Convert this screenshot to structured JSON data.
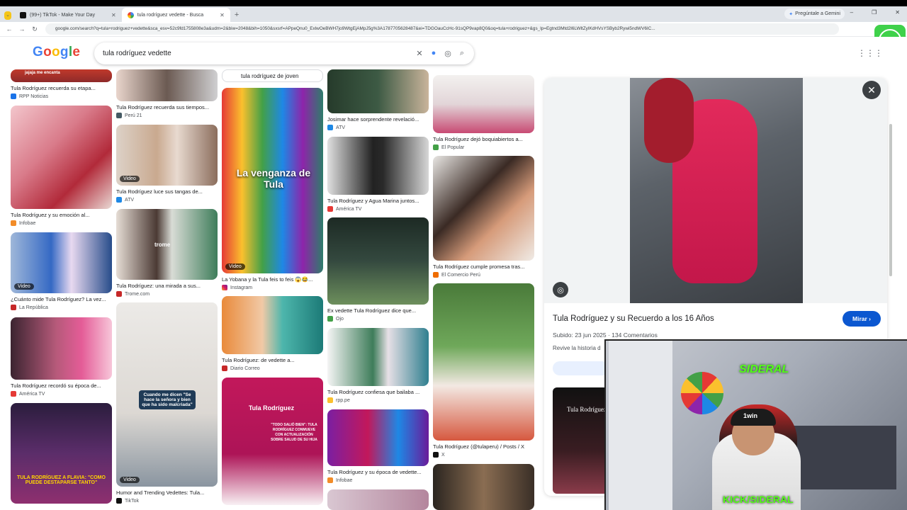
{
  "browser": {
    "tabs": [
      {
        "label": "(99+) TikTok - Make Your Day",
        "active": false
      },
      {
        "label": "tula rodríguez vedette - Busca",
        "active": true
      }
    ],
    "gemini_label": "Pregúntale a Gemini",
    "url": "google.com/search?q=tula+rodriguez+vedette&sca_esv=52c9fd1755808e3a&udm=2&biw=2048&bih=1050&sxsrf=APpeQnu0_ExlwOeBWH7jo9WtgEjAMpJ5g%3A1787705628487&ei=TDGOauCcHc-91sQP9vap8Q0&oq=tula+rodriguez+&gs_lp=Egtnd3Mtd2l6LWltZyIKdHVsYSByb2Rywi5ndWV6IC..."
  },
  "age_badge": "18",
  "google": {
    "logo": "Google",
    "query": "tula rodríguez vedette"
  },
  "results": {
    "col1": [
      {
        "caption": "Tula Rodríguez recuerda su etapa...",
        "source": "RPP Noticias",
        "overlay": "jajaja me encanta"
      },
      {
        "caption": "Tula Rodríguez y su emoción al...",
        "source": "Infobae"
      },
      {
        "caption": "¿Cuánto mide Tula Rodríguez? La vez...",
        "source": "La República",
        "video": "Video"
      },
      {
        "caption": "Tula Rodríguez recordó su época de...",
        "source": "América TV"
      },
      {
        "caption": "",
        "source": "",
        "overlay": "TULA RODRÍGUEZ A FLAVIA: \"COMO PUEDE DESTAPARSE TANTO\""
      }
    ],
    "col2": [
      {
        "caption": "Tula Rodríguez recuerda sus tiempos...",
        "source": "Perú 21"
      },
      {
        "caption": "Tula Rodríguez luce sus tangas de...",
        "source": "ATV",
        "video": "Video"
      },
      {
        "caption": "Tula Rodríguez: una mirada a sus...",
        "source": "Trome.com",
        "overlay": "trome"
      },
      {
        "caption": "Humor and Trending Vedettes: Tula...",
        "source": "TikTok",
        "video": "Video",
        "overlay": "Cuando me dicen \"Se hace la señora y bien que ha sido malcriada\""
      }
    ],
    "col3": [
      {
        "caption": "tula rodríguez de joven",
        "source": ""
      },
      {
        "caption": "La Yobana y la Tula feis to feis 😱😂...",
        "source": "Instagram",
        "video": "Video",
        "overlay": "La venganza de Tula"
      },
      {
        "caption": "Tula Rodríguez: de vedette a...",
        "source": "Diario Correo"
      },
      {
        "caption": "",
        "source": "",
        "overlay": "Tula Rodríguez",
        "overlay2": "\"TODO SALIÓ BIEN\": TULA RODRÍGUEZ CONMUEVE CON ACTUALIZACIÓN SOBRE SALUD DE SU HIJA"
      }
    ],
    "col4": [
      {
        "caption": "Josimar hace sorprendente revelació...",
        "source": "ATV"
      },
      {
        "caption": "Tula Rodríguez y Agua Marina juntos...",
        "source": "América TV"
      },
      {
        "caption": "Ex vedette Tula Rodríguez dice que...",
        "source": "Ojo"
      },
      {
        "caption": "Tula Rodríguez confiesa que bailaba ...",
        "source": "rpp.pe"
      },
      {
        "caption": "Tula Rodríguez y su época de vedette...",
        "source": "Infobae"
      }
    ],
    "col5": [
      {
        "caption": "Tula Rodríguez dejó boquiabiertos a...",
        "source": "El Popular"
      },
      {
        "caption": "Tula Rodríguez cumple promesa tras...",
        "source": "El Comercio Perú"
      },
      {
        "caption": "Tula Rodríguez (@tulaperu) / Posts / X",
        "source": "X"
      }
    ]
  },
  "panel": {
    "title": "Tula Rodríguez y su Recuerdo a los 16 Años",
    "meta": "Subido: 23 jun 2025 · 134 Comentarios",
    "desc": "Revive la historia d",
    "cta": "Mirar",
    "thumb_text": "Tula Rodríguez"
  },
  "webcam": {
    "brand": "SIDERAL",
    "footer": "KICK/SIDERAL",
    "cap_text": "1win"
  },
  "colors": {
    "accent": "#0b57d0",
    "kick": "#53fc18"
  }
}
